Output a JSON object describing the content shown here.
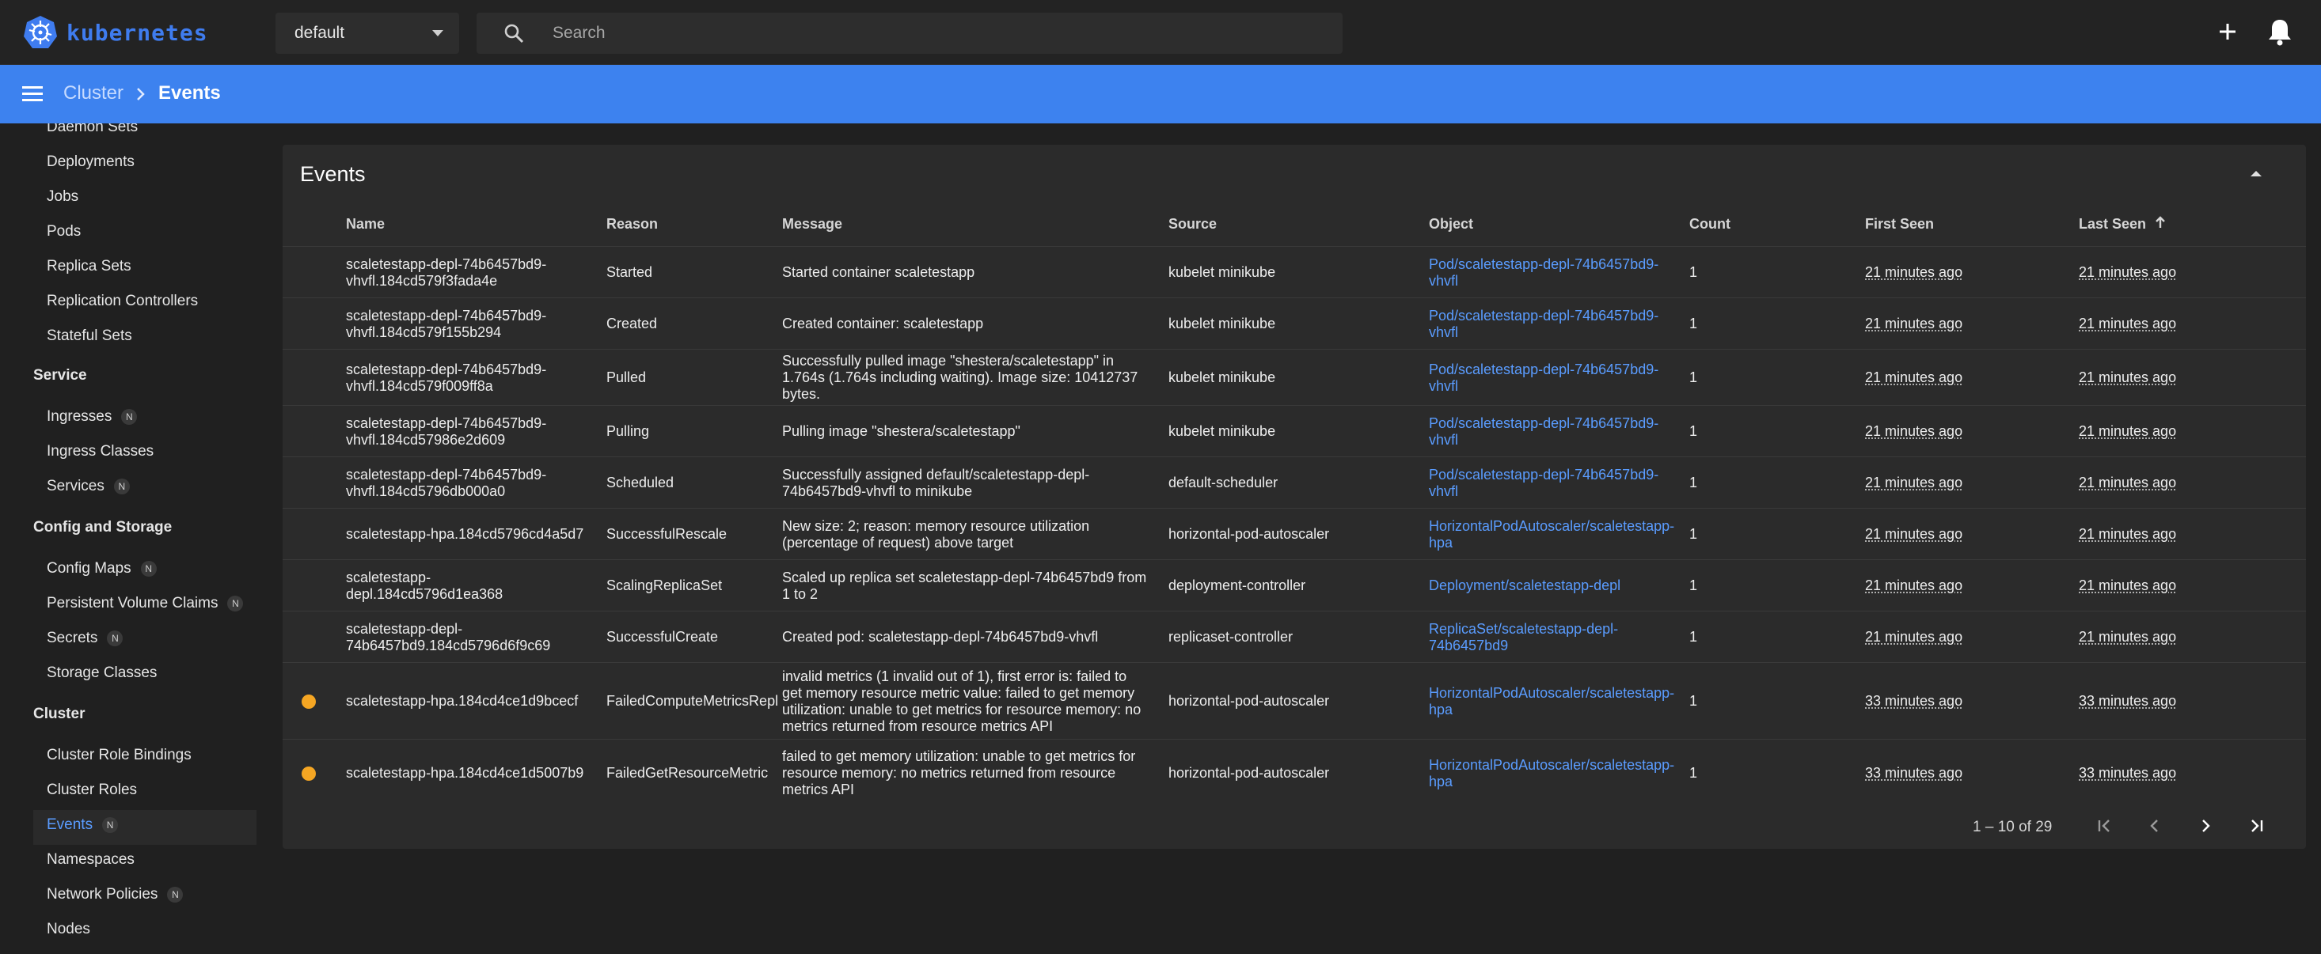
{
  "app": {
    "name": "kubernetes"
  },
  "topbar": {
    "namespace": "default",
    "search_placeholder": "Search"
  },
  "breadcrumb": {
    "parent": "Cluster",
    "current": "Events"
  },
  "sidebar": {
    "items_top": [
      "Daemon Sets",
      "Deployments",
      "Jobs",
      "Pods",
      "Replica Sets",
      "Replication Controllers",
      "Stateful Sets"
    ],
    "section_service": "Service",
    "service_items": [
      "Ingresses",
      "Ingress Classes",
      "Services"
    ],
    "section_config": "Config and Storage",
    "config_items": [
      "Config Maps",
      "Persistent Volume Claims",
      "Secrets",
      "Storage Classes"
    ],
    "section_cluster": "Cluster",
    "cluster_items": [
      "Cluster Role Bindings",
      "Cluster Roles",
      "Events",
      "Namespaces",
      "Network Policies",
      "Nodes"
    ],
    "badge": "N"
  },
  "panel": {
    "title": "Events",
    "columns": [
      "Name",
      "Reason",
      "Message",
      "Source",
      "Object",
      "Count",
      "First Seen",
      "Last Seen"
    ],
    "rows": [
      {
        "name": [
          "scaletestapp-depl-74b6457bd9-",
          "vhvfl.184cd579f3fada4e"
        ],
        "reason": "Started",
        "message": [
          "Started container scaletestapp"
        ],
        "source": "kubelet minikube",
        "object": [
          "Pod/scaletestapp-depl-74b6457bd9-",
          "vhvfl"
        ],
        "count": "1",
        "first": "21 minutes ago",
        "last": "21 minutes ago",
        "warn": false
      },
      {
        "name": [
          "scaletestapp-depl-74b6457bd9-",
          "vhvfl.184cd579f155b294"
        ],
        "reason": "Created",
        "message": [
          "Created container: scaletestapp"
        ],
        "source": "kubelet minikube",
        "object": [
          "Pod/scaletestapp-depl-74b6457bd9-",
          "vhvfl"
        ],
        "count": "1",
        "first": "21 minutes ago",
        "last": "21 minutes ago",
        "warn": false
      },
      {
        "name": [
          "scaletestapp-depl-74b6457bd9-",
          "vhvfl.184cd579f009ff8a"
        ],
        "reason": "Pulled",
        "message": [
          "Successfully pulled image \"shestera/scaletestapp\" in",
          "1.764s (1.764s including waiting). Image size: 10412737",
          "bytes."
        ],
        "source": "kubelet minikube",
        "object": [
          "Pod/scaletestapp-depl-74b6457bd9-",
          "vhvfl"
        ],
        "count": "1",
        "first": "21 minutes ago",
        "last": "21 minutes ago",
        "warn": false
      },
      {
        "name": [
          "scaletestapp-depl-74b6457bd9-",
          "vhvfl.184cd57986e2d609"
        ],
        "reason": "Pulling",
        "message": [
          "Pulling image \"shestera/scaletestapp\""
        ],
        "source": "kubelet minikube",
        "object": [
          "Pod/scaletestapp-depl-74b6457bd9-",
          "vhvfl"
        ],
        "count": "1",
        "first": "21 minutes ago",
        "last": "21 minutes ago",
        "warn": false
      },
      {
        "name": [
          "scaletestapp-depl-74b6457bd9-",
          "vhvfl.184cd5796db000a0"
        ],
        "reason": "Scheduled",
        "message": [
          "Successfully assigned default/scaletestapp-depl-",
          "74b6457bd9-vhvfl to minikube"
        ],
        "source": "default-scheduler",
        "object": [
          "Pod/scaletestapp-depl-74b6457bd9-",
          "vhvfl"
        ],
        "count": "1",
        "first": "21 minutes ago",
        "last": "21 minutes ago",
        "warn": false
      },
      {
        "name": [
          "scaletestapp-hpa.184cd5796cd4a5d7"
        ],
        "reason": "SuccessfulRescale",
        "message": [
          "New size: 2; reason: memory resource utilization",
          "(percentage of request) above target"
        ],
        "source": "horizontal-pod-autoscaler",
        "object": [
          "HorizontalPodAutoscaler/scaletestapp-",
          "hpa"
        ],
        "count": "1",
        "first": "21 minutes ago",
        "last": "21 minutes ago",
        "warn": false
      },
      {
        "name": [
          "scaletestapp-",
          "depl.184cd5796d1ea368"
        ],
        "reason": "ScalingReplicaSet",
        "message": [
          "Scaled up replica set scaletestapp-depl-74b6457bd9 from",
          "1 to 2"
        ],
        "source": "deployment-controller",
        "object": [
          "Deployment/scaletestapp-depl"
        ],
        "count": "1",
        "first": "21 minutes ago",
        "last": "21 minutes ago",
        "warn": false
      },
      {
        "name": [
          "scaletestapp-depl-",
          "74b6457bd9.184cd5796d6f9c69"
        ],
        "reason": "SuccessfulCreate",
        "message": [
          "Created pod: scaletestapp-depl-74b6457bd9-vhvfl"
        ],
        "source": "replicaset-controller",
        "object": [
          "ReplicaSet/scaletestapp-depl-",
          "74b6457bd9"
        ],
        "count": "1",
        "first": "21 minutes ago",
        "last": "21 minutes ago",
        "warn": false
      },
      {
        "name": [
          "scaletestapp-hpa.184cd4ce1d9bcecf"
        ],
        "reason": "FailedComputeMetricsReplicas",
        "message": [
          "invalid metrics (1 invalid out of 1), first error is: failed to",
          "get memory resource metric value: failed to get memory",
          "utilization: unable to get metrics for resource memory: no",
          "metrics returned from resource metrics API"
        ],
        "source": "horizontal-pod-autoscaler",
        "object": [
          "HorizontalPodAutoscaler/scaletestapp-",
          "hpa"
        ],
        "count": "1",
        "first": "33 minutes ago",
        "last": "33 minutes ago",
        "warn": true
      },
      {
        "name": [
          "scaletestapp-hpa.184cd4ce1d5007b9"
        ],
        "reason": "FailedGetResourceMetric",
        "message": [
          "failed to get memory utilization: unable to get metrics for",
          "resource memory: no metrics returned from resource",
          "metrics API"
        ],
        "source": "horizontal-pod-autoscaler",
        "object": [
          "HorizontalPodAutoscaler/scaletestapp-",
          "hpa"
        ],
        "count": "1",
        "first": "33 minutes ago",
        "last": "33 minutes ago",
        "warn": true
      }
    ],
    "pagination": "1 – 10 of 29"
  },
  "colors": {
    "accent": "#3d82ef",
    "link": "#5a9cff",
    "warning": "#f5a623",
    "background": "#202020",
    "panel": "#2b2b2b"
  },
  "icons": [
    "kubernetes-logo-icon",
    "chevron-down-icon",
    "search-icon",
    "plus-icon",
    "bell-icon",
    "menu-icon",
    "chevron-right-icon",
    "collapse-icon",
    "arrow-up-icon",
    "first-page-icon",
    "prev-page-icon",
    "next-page-icon",
    "last-page-icon"
  ]
}
